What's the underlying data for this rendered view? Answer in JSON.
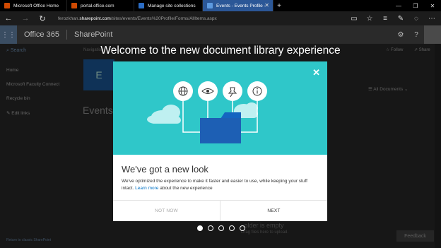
{
  "browser": {
    "tabs": [
      {
        "title": "Microsoft Office Home",
        "icon_color": "#d04a02"
      },
      {
        "title": "portal.office.com",
        "icon_color": "#d04a02"
      },
      {
        "title": "Manage site collections",
        "icon_color": "#2b6cc4"
      },
      {
        "title": "Events - Events Profile -",
        "icon_color": "#2b6cc4"
      }
    ],
    "url_prefix": "ferozkhan.",
    "url_domain": "sharepoint.com",
    "url_path": "/sites/events/Events%20Profile/Forms/AllItems.aspx"
  },
  "suite": {
    "app_name": "Office 365",
    "site_name": "SharePoint"
  },
  "page": {
    "search_label": "Search",
    "nav_items": [
      "Home",
      "Microsoft Faculty Connect",
      "Recycle bin",
      "Edit links"
    ],
    "return_link": "Return to classic SharePoint",
    "navigation_hint": "Navigation",
    "site_tile_letter": "E",
    "heading": "Events P",
    "follow": "Follow",
    "share": "Share",
    "view_label": "All Documents",
    "empty_text": "...older is empty",
    "drag_hint": "Drag files here to upload.",
    "feedback": "Feedback"
  },
  "welcome": "Welcome to the new document library experience",
  "dialog": {
    "title": "We've got a new look",
    "body_before": "We've optimized the experience to make it faster and easier to use, while keeping your stuff intact. ",
    "learn_more": "Learn more",
    "body_after": " about the new experience",
    "not_now": "NOT NOW",
    "next": "NEXT"
  },
  "carousel": {
    "total": 5,
    "active": 1
  },
  "colors": {
    "hero": "#2fc7c9",
    "folder": "#1d5fb4",
    "link": "#0072c6",
    "active_tab": "#2b5797"
  }
}
